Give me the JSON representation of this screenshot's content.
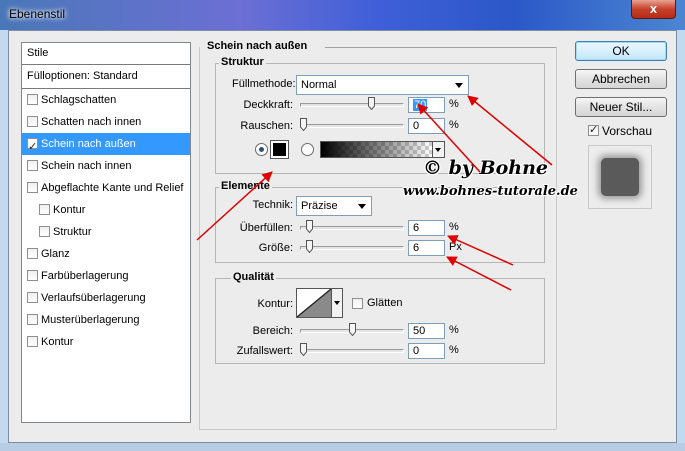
{
  "window": {
    "title": "Ebenenstil",
    "close_glyph": "x"
  },
  "styles_list": {
    "header": "Stile",
    "fill_options": "Fülloptionen: Standard",
    "items": [
      {
        "label": "Schlagschatten",
        "checked": false,
        "selected": false,
        "sub": false
      },
      {
        "label": "Schatten nach innen",
        "checked": false,
        "selected": false,
        "sub": false
      },
      {
        "label": "Schein nach außen",
        "checked": true,
        "selected": true,
        "sub": false
      },
      {
        "label": "Schein nach innen",
        "checked": false,
        "selected": false,
        "sub": false
      },
      {
        "label": "Abgeflachte Kante und Relief",
        "checked": false,
        "selected": false,
        "sub": false
      },
      {
        "label": "Kontur",
        "checked": false,
        "selected": false,
        "sub": true
      },
      {
        "label": "Struktur",
        "checked": false,
        "selected": false,
        "sub": true
      },
      {
        "label": "Glanz",
        "checked": false,
        "selected": false,
        "sub": false
      },
      {
        "label": "Farbüberlagerung",
        "checked": false,
        "selected": false,
        "sub": false
      },
      {
        "label": "Verlaufsüberlagerung",
        "checked": false,
        "selected": false,
        "sub": false
      },
      {
        "label": "Musterüberlagerung",
        "checked": false,
        "selected": false,
        "sub": false
      },
      {
        "label": "Kontur",
        "checked": false,
        "selected": false,
        "sub": false
      }
    ]
  },
  "panel": {
    "title": "Schein nach außen",
    "struktur": {
      "title": "Struktur",
      "blend_mode_label": "Füllmethode:",
      "blend_mode_value": "Normal",
      "opacity_label": "Deckkraft:",
      "opacity_value": "70",
      "opacity_level": 70,
      "opacity_unit": "%",
      "noise_label": "Rauschen:",
      "noise_value": "0",
      "noise_level": 0,
      "noise_unit": "%"
    },
    "elemente": {
      "title": "Elemente",
      "technique_label": "Technik:",
      "technique_value": "Präzise",
      "spread_label": "Überfüllen:",
      "spread_value": "6",
      "spread_level": 6,
      "spread_unit": "%",
      "size_label": "Größe:",
      "size_value": "6",
      "size_level": 6,
      "size_unit": "Px"
    },
    "qualitaet": {
      "title": "Qualität",
      "contour_label": "Kontur:",
      "antialias_label": "Glätten",
      "range_label": "Bereich:",
      "range_value": "50",
      "range_level": 50,
      "range_unit": "%",
      "jitter_label": "Zufallswert:",
      "jitter_value": "0",
      "jitter_level": 0,
      "jitter_unit": "%"
    }
  },
  "buttons": {
    "ok": "OK",
    "cancel": "Abbrechen",
    "new_style": "Neuer Stil...",
    "preview_label": "Vorschau",
    "preview_checked": true
  },
  "watermark": {
    "line1": "© by Bohne",
    "line2": "www.bohnes-tutorale.de"
  },
  "colors": {
    "selection": "#3399ff",
    "glow_color": "#000000",
    "arrow_color": "#e00000"
  }
}
